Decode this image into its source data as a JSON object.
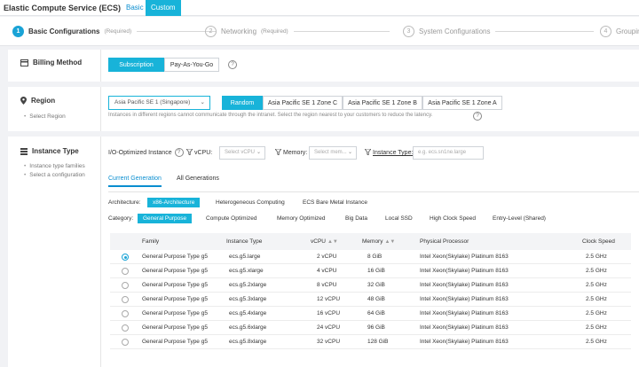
{
  "header": {
    "title": "Elastic Compute Service (ECS)",
    "tabs": [
      {
        "label": "Basic"
      },
      {
        "label": "Custom"
      }
    ]
  },
  "steps": [
    {
      "num": "1",
      "label": "Basic Configurations",
      "req": "(Required)"
    },
    {
      "num": "2",
      "label": "Networking",
      "req": "(Required)"
    },
    {
      "num": "3",
      "label": "System Configurations",
      "req": ""
    },
    {
      "num": "4",
      "label": "Grouping",
      "req": ""
    }
  ],
  "billing": {
    "title": "Billing Method",
    "options": [
      "Subscription",
      "Pay-As-You-Go"
    ],
    "help": "?"
  },
  "region": {
    "title": "Region",
    "side": [
      "Select Region"
    ],
    "selected": "Asia Pacific SE 1 (Singapore)",
    "zones": [
      "Random",
      "Asia Pacific SE 1 Zone C",
      "Asia Pacific SE 1 Zone B",
      "Asia Pacific SE 1 Zone A"
    ],
    "note": "Instances in different regions cannot communicate through the intranet. Select the region nearest to your customers to reduce the latency.",
    "help": "?"
  },
  "instance": {
    "title": "Instance Type",
    "side": [
      "Instance type families",
      "Select a configuration"
    ],
    "filters": {
      "io_label": "I/O-Optimized Instance",
      "vcpu_label": "vCPU:",
      "vcpu_placeholder": "Select vCPU",
      "memory_label": "Memory:",
      "memory_placeholder": "Select mem...",
      "type_label": "Instance Type:",
      "type_placeholder": "e.g. ecs.sn1ne.large"
    },
    "generation_tabs": [
      "Current Generation",
      "All Generations"
    ],
    "architecture_label": "Architecture:",
    "architectures": [
      "x86-Architecture",
      "Heterogeneous Computing",
      "ECS Bare Metal Instance"
    ],
    "category_label": "Category:",
    "categories": [
      "General Purpose",
      "Compute Optimized",
      "Memory Optimized",
      "Big Data",
      "Local SSD",
      "High Clock Speed",
      "Entry-Level (Shared)"
    ],
    "columns": {
      "family": "Family",
      "type": "Instance Type",
      "vcpu": "vCPU",
      "memory": "Memory",
      "processor": "Physical Processor",
      "clock": "Clock Speed"
    },
    "rows": [
      {
        "family": "General Purpose Type g5",
        "type": "ecs.g5.large",
        "vcpu": "2 vCPU",
        "memory": "8 GiB",
        "processor": "Intel Xeon(Skylake) Platinum 8163",
        "clock": "2.5 GHz",
        "selected": true
      },
      {
        "family": "General Purpose Type g5",
        "type": "ecs.g5.xlarge",
        "vcpu": "4 vCPU",
        "memory": "16 GiB",
        "processor": "Intel Xeon(Skylake) Platinum 8163",
        "clock": "2.5 GHz",
        "selected": false
      },
      {
        "family": "General Purpose Type g5",
        "type": "ecs.g5.2xlarge",
        "vcpu": "8 vCPU",
        "memory": "32 GiB",
        "processor": "Intel Xeon(Skylake) Platinum 8163",
        "clock": "2.5 GHz",
        "selected": false
      },
      {
        "family": "General Purpose Type g5",
        "type": "ecs.g5.3xlarge",
        "vcpu": "12 vCPU",
        "memory": "48 GiB",
        "processor": "Intel Xeon(Skylake) Platinum 8163",
        "clock": "2.5 GHz",
        "selected": false
      },
      {
        "family": "General Purpose Type g5",
        "type": "ecs.g5.4xlarge",
        "vcpu": "16 vCPU",
        "memory": "64 GiB",
        "processor": "Intel Xeon(Skylake) Platinum 8163",
        "clock": "2.5 GHz",
        "selected": false
      },
      {
        "family": "General Purpose Type g5",
        "type": "ecs.g5.6xlarge",
        "vcpu": "24 vCPU",
        "memory": "96 GiB",
        "processor": "Intel Xeon(Skylake) Platinum 8163",
        "clock": "2.5 GHz",
        "selected": false
      },
      {
        "family": "General Purpose Type g5",
        "type": "ecs.g5.8xlarge",
        "vcpu": "32 vCPU",
        "memory": "128 GiB",
        "processor": "Intel Xeon(Skylake) Platinum 8163",
        "clock": "2.5 GHz",
        "selected": false
      }
    ]
  },
  "colors": {
    "accent": "#18b3d9",
    "link": "#0a8ed0"
  }
}
